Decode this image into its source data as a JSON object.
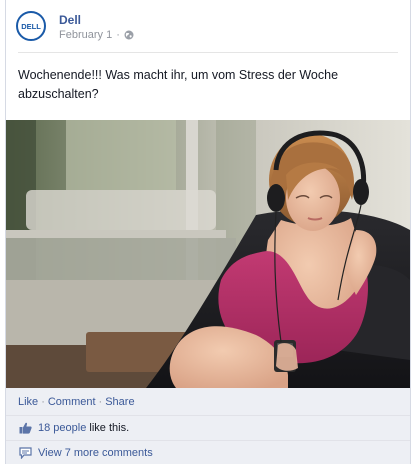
{
  "post": {
    "author": "Dell",
    "logo_text": "DELL",
    "date": "February 1",
    "audience_icon": "globe-icon",
    "text": "Wochenende!!! Was macht ihr, um vom Stress der Woche abzuschalten?"
  },
  "photo": {
    "subject": "woman-with-headphones-photo"
  },
  "actions": {
    "like": "Like",
    "comment": "Comment",
    "share": "Share",
    "separator": "·"
  },
  "likes": {
    "icon": "thumbs-up-icon",
    "count_text": "18 people",
    "suffix": "like this."
  },
  "comments": {
    "icon": "comment-icon",
    "view_more": "View 7 more comments"
  },
  "colors": {
    "link": "#3b5998",
    "ufi_background": "#edeff4",
    "brand_blue": "#1a5aa8"
  }
}
